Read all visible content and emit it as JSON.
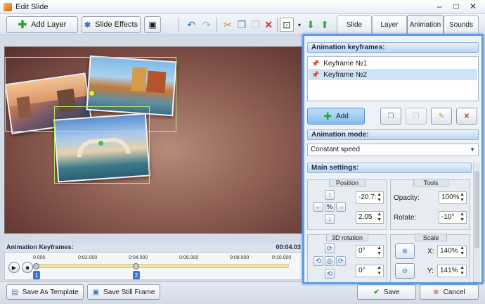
{
  "window": {
    "title": "Edit Slide"
  },
  "toolbar": {
    "add_layer_label": "Add Layer",
    "slide_effects_label": "Slide Effects"
  },
  "tabs": [
    {
      "label": "Slide"
    },
    {
      "label": "Layer"
    },
    {
      "label": "Animation",
      "active": true
    },
    {
      "label": "Sounds"
    }
  ],
  "timeline": {
    "header_label": "Animation Keyframes:",
    "current_time": "00:04.03",
    "ticks": [
      "0.000",
      "0:02.000",
      "0:04.000",
      "0:06.000",
      "0:08.000",
      "0:10.000"
    ],
    "markers": [
      {
        "label": "1",
        "position": 0.0
      },
      {
        "label": "2",
        "position": 0.4
      }
    ]
  },
  "bottom": {
    "save_template_label": "Save As Template",
    "save_still_label": "Save Still Frame",
    "save_label": "Save",
    "cancel_label": "Cancel"
  },
  "panel": {
    "keyframes_header": "Animation keyframes:",
    "keyframes": [
      {
        "label": "Keyframe №1",
        "selected": false
      },
      {
        "label": "Keyframe №2",
        "selected": true
      }
    ],
    "add_label": "Add",
    "mode_header": "Animation mode:",
    "mode_value": "Constant speed",
    "main_header": "Main settings:",
    "position_title": "Position",
    "position_x": "-20.7:",
    "position_y": "2.05",
    "percent_symbol": "%",
    "tools_title": "Tools",
    "opacity_label": "Opacity:",
    "opacity_value": "100%",
    "rotate_label": "Rotate:",
    "rotate_value": "-10°",
    "rotation3d_title": "3D rotation",
    "rot_x": "0°",
    "rot_y": "0°",
    "scale_title": "Scale",
    "scale_x_label": "X:",
    "scale_x": "140%",
    "scale_y_label": "Y:",
    "scale_y": "141%"
  },
  "colors": {
    "panel_border": "#5b9ee6",
    "selection_border": "#b6e86a",
    "selected_row": "#cfe3f6",
    "keyframe_badge": "#3d76c4"
  }
}
